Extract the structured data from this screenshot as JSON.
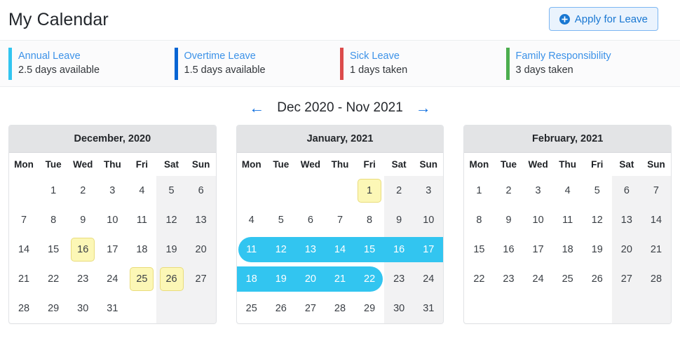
{
  "header": {
    "title": "My Calendar",
    "apply_button": "Apply for Leave",
    "apply_icon": "plus-circle-icon"
  },
  "leave_types": [
    {
      "name": "Annual Leave",
      "detail": "2.5 days available",
      "color": "#32c5f0"
    },
    {
      "name": "Overtime Leave",
      "detail": "1.5 days available",
      "color": "#0765d4"
    },
    {
      "name": "Sick Leave",
      "detail": "1 days taken",
      "color": "#dc4b4b"
    },
    {
      "name": "Family Responsibility",
      "detail": "3 days taken",
      "color": "#4cae4f"
    }
  ],
  "nav": {
    "prev_icon": "arrow-left-icon",
    "next_icon": "arrow-right-icon",
    "range": "Dec 2020 - Nov 2021"
  },
  "weekdays": [
    "Mon",
    "Tue",
    "Wed",
    "Thu",
    "Fri",
    "Sat",
    "Sun"
  ],
  "months": [
    {
      "title": "December, 2020",
      "weeks": [
        [
          {
            "d": ""
          },
          {
            "d": "1"
          },
          {
            "d": "2"
          },
          {
            "d": "3"
          },
          {
            "d": "4"
          },
          {
            "d": "5",
            "we": true
          },
          {
            "d": "6",
            "we": true
          }
        ],
        [
          {
            "d": "7"
          },
          {
            "d": "8"
          },
          {
            "d": "9"
          },
          {
            "d": "10"
          },
          {
            "d": "11"
          },
          {
            "d": "12",
            "we": true
          },
          {
            "d": "13",
            "we": true
          }
        ],
        [
          {
            "d": "14"
          },
          {
            "d": "15"
          },
          {
            "d": "16",
            "holiday": true
          },
          {
            "d": "17"
          },
          {
            "d": "18"
          },
          {
            "d": "19",
            "we": true
          },
          {
            "d": "20",
            "we": true
          }
        ],
        [
          {
            "d": "21"
          },
          {
            "d": "22"
          },
          {
            "d": "23"
          },
          {
            "d": "24"
          },
          {
            "d": "25",
            "holiday": true
          },
          {
            "d": "26",
            "we": true,
            "holiday": true
          },
          {
            "d": "27",
            "we": true
          }
        ],
        [
          {
            "d": "28"
          },
          {
            "d": "29"
          },
          {
            "d": "30"
          },
          {
            "d": "31"
          },
          {
            "d": ""
          },
          {
            "d": "",
            "we": true
          },
          {
            "d": "",
            "we": true
          }
        ]
      ]
    },
    {
      "title": "January, 2021",
      "weeks": [
        [
          {
            "d": ""
          },
          {
            "d": ""
          },
          {
            "d": ""
          },
          {
            "d": ""
          },
          {
            "d": "1",
            "holiday": true
          },
          {
            "d": "2",
            "we": true
          },
          {
            "d": "3",
            "we": true
          }
        ],
        [
          {
            "d": "4"
          },
          {
            "d": "5"
          },
          {
            "d": "6"
          },
          {
            "d": "7"
          },
          {
            "d": "8"
          },
          {
            "d": "9",
            "we": true
          },
          {
            "d": "10",
            "we": true
          }
        ],
        [
          {
            "d": "11",
            "range": "start"
          },
          {
            "d": "12",
            "range": "mid"
          },
          {
            "d": "13",
            "range": "mid"
          },
          {
            "d": "14",
            "range": "mid"
          },
          {
            "d": "15",
            "range": "mid"
          },
          {
            "d": "16",
            "we": true,
            "range": "mid"
          },
          {
            "d": "17",
            "we": true,
            "range": "mid"
          }
        ],
        [
          {
            "d": "18",
            "range": "mid"
          },
          {
            "d": "19",
            "range": "mid"
          },
          {
            "d": "20",
            "range": "mid"
          },
          {
            "d": "21",
            "range": "mid"
          },
          {
            "d": "22",
            "range": "end"
          },
          {
            "d": "23",
            "we": true
          },
          {
            "d": "24",
            "we": true
          }
        ],
        [
          {
            "d": "25"
          },
          {
            "d": "26"
          },
          {
            "d": "27"
          },
          {
            "d": "28"
          },
          {
            "d": "29"
          },
          {
            "d": "30",
            "we": true
          },
          {
            "d": "31",
            "we": true
          }
        ]
      ]
    },
    {
      "title": "February, 2021",
      "weeks": [
        [
          {
            "d": "1"
          },
          {
            "d": "2"
          },
          {
            "d": "3"
          },
          {
            "d": "4"
          },
          {
            "d": "5"
          },
          {
            "d": "6",
            "we": true
          },
          {
            "d": "7",
            "we": true
          }
        ],
        [
          {
            "d": "8"
          },
          {
            "d": "9"
          },
          {
            "d": "10"
          },
          {
            "d": "11"
          },
          {
            "d": "12"
          },
          {
            "d": "13",
            "we": true
          },
          {
            "d": "14",
            "we": true
          }
        ],
        [
          {
            "d": "15"
          },
          {
            "d": "16"
          },
          {
            "d": "17"
          },
          {
            "d": "18"
          },
          {
            "d": "19"
          },
          {
            "d": "20",
            "we": true
          },
          {
            "d": "21",
            "we": true
          }
        ],
        [
          {
            "d": "22"
          },
          {
            "d": "23"
          },
          {
            "d": "24"
          },
          {
            "d": "25"
          },
          {
            "d": "26"
          },
          {
            "d": "27",
            "we": true
          },
          {
            "d": "28",
            "we": true
          }
        ],
        [
          {
            "d": ""
          },
          {
            "d": ""
          },
          {
            "d": ""
          },
          {
            "d": ""
          },
          {
            "d": ""
          },
          {
            "d": "",
            "we": true
          },
          {
            "d": "",
            "we": true
          }
        ]
      ]
    }
  ]
}
